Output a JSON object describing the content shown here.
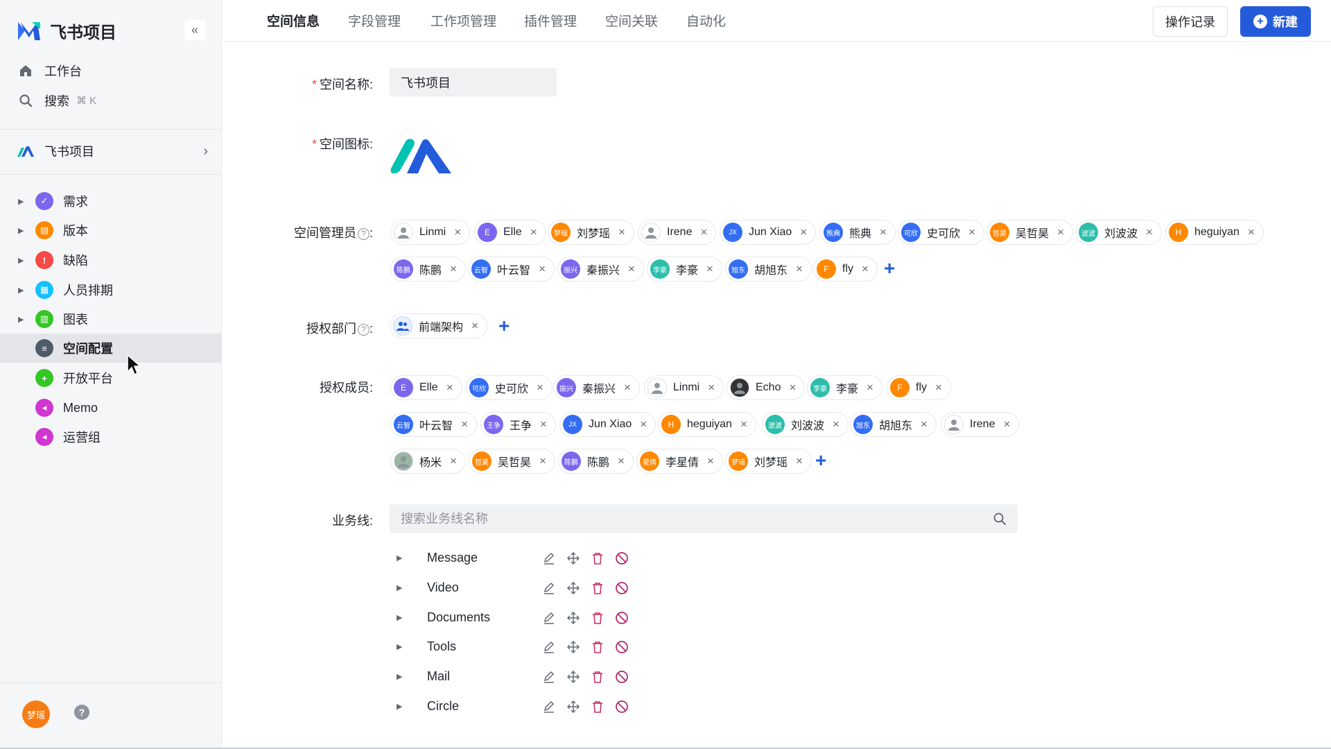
{
  "colors": {
    "primary": "#245bdb",
    "danger": "#f54a45",
    "sidebar_bg": "#f5f6f7",
    "trash": "#c73064",
    "ban": "#b2226b"
  },
  "sidebar": {
    "brand": "飞书项目",
    "collapse_icon": "double-chevron-left-icon",
    "workbench": "工作台",
    "search": "搜索",
    "search_shortcut": "⌘ K",
    "space_name": "飞书项目",
    "tree": [
      {
        "label": "需求",
        "icon": "requirement-icon",
        "color": "#7b67ee",
        "glyph": "✓"
      },
      {
        "label": "版本",
        "icon": "version-icon",
        "color": "#ff8800",
        "glyph": "▤"
      },
      {
        "label": "缺陷",
        "icon": "bug-icon",
        "color": "#f54a45",
        "glyph": "!"
      },
      {
        "label": "人员排期",
        "icon": "schedule-icon",
        "color": "#14c0ff",
        "glyph": "▦"
      },
      {
        "label": "图表",
        "icon": "chart-icon",
        "color": "#34c724",
        "glyph": "▥"
      },
      {
        "label": "空间配置",
        "icon": "settings-icon",
        "color": "#4e5969",
        "glyph": "≡"
      },
      {
        "label": "开放平台",
        "icon": "open-platform-icon",
        "color": "#34c724",
        "glyph": "+"
      },
      {
        "label": "Memo",
        "icon": "memo-icon",
        "color": "#d136d1",
        "glyph": "◂"
      },
      {
        "label": "运营组",
        "icon": "ops-icon",
        "color": "#d136d1",
        "glyph": "◂"
      }
    ],
    "user_avatar_text": "梦瑶",
    "help_glyph": "?"
  },
  "tabs": [
    "空间信息",
    "字段管理",
    "工作项管理",
    "插件管理",
    "空间关联",
    "自动化"
  ],
  "actions": {
    "log": "操作记录",
    "new": "新建"
  },
  "form": {
    "name_label": "空间名称:",
    "name_value": "飞书项目",
    "icon_label": "空间图标:",
    "admin_label": "空间管理员",
    "dept_label": "授权部门",
    "member_label": "授权成员:",
    "bizline_label": "业务线:",
    "bizline_placeholder": "搜索业务线名称"
  },
  "admins": [
    {
      "name": "Linmi",
      "av": "",
      "color": "#ffffff",
      "photo": true
    },
    {
      "name": "Elle",
      "av": "E",
      "color": "#7b67ee"
    },
    {
      "name": "刘梦瑶",
      "av": "梦瑶",
      "color": "#ff8800"
    },
    {
      "name": "Irene",
      "av": "",
      "color": "#ffffff",
      "photo": true
    },
    {
      "name": "Jun Xiao",
      "av": "JX",
      "color": "#336df4"
    },
    {
      "name": "熊典",
      "av": "熊典",
      "color": "#336df4"
    },
    {
      "name": "史可欣",
      "av": "可欣",
      "color": "#336df4"
    },
    {
      "name": "吴哲昊",
      "av": "哲昊",
      "color": "#ff8800"
    },
    {
      "name": "刘波波",
      "av": "波波",
      "color": "#2dbeab"
    },
    {
      "name": "heguiyan",
      "av": "H",
      "color": "#ff8800"
    },
    {
      "name": "陈鹏",
      "av": "陈鹏",
      "color": "#7b67ee"
    },
    {
      "name": "叶云智",
      "av": "云智",
      "color": "#336df4"
    },
    {
      "name": "秦振兴",
      "av": "振兴",
      "color": "#7b67ee"
    },
    {
      "name": "李豪",
      "av": "李豪",
      "color": "#2dbeab"
    },
    {
      "name": "胡旭东",
      "av": "旭东",
      "color": "#336df4"
    },
    {
      "name": "fly",
      "av": "F",
      "color": "#ff8800"
    }
  ],
  "departments": [
    {
      "name": "前端架构"
    }
  ],
  "members": [
    {
      "name": "Elle",
      "av": "E",
      "color": "#7b67ee"
    },
    {
      "name": "史可欣",
      "av": "可欣",
      "color": "#336df4"
    },
    {
      "name": "秦振兴",
      "av": "振兴",
      "color": "#7b67ee"
    },
    {
      "name": "Linmi",
      "av": "",
      "color": "#ffffff",
      "photo": true
    },
    {
      "name": "Echo",
      "av": "",
      "color": "#333333",
      "photo": true
    },
    {
      "name": "李豪",
      "av": "李豪",
      "color": "#2dbeab"
    },
    {
      "name": "fly",
      "av": "F",
      "color": "#ff8800"
    },
    {
      "name": "叶云智",
      "av": "云智",
      "color": "#336df4"
    },
    {
      "name": "王争",
      "av": "王争",
      "color": "#7b67ee"
    },
    {
      "name": "Jun Xiao",
      "av": "JX",
      "color": "#336df4"
    },
    {
      "name": "heguiyan",
      "av": "H",
      "color": "#ff8800"
    },
    {
      "name": "刘波波",
      "av": "波波",
      "color": "#2dbeab"
    },
    {
      "name": "胡旭东",
      "av": "旭东",
      "color": "#336df4"
    },
    {
      "name": "Irene",
      "av": "",
      "color": "#ffffff",
      "photo": true
    },
    {
      "name": "杨米",
      "av": "",
      "color": "#9bb5a5",
      "photo": true
    },
    {
      "name": "吴哲昊",
      "av": "哲昊",
      "color": "#ff8800"
    },
    {
      "name": "陈鹏",
      "av": "陈鹏",
      "color": "#7b67ee"
    },
    {
      "name": "李星倩",
      "av": "星倩",
      "color": "#ff8800"
    },
    {
      "name": "刘梦瑶",
      "av": "梦瑶",
      "color": "#ff8800"
    }
  ],
  "business_lines": [
    "Message",
    "Video",
    "Documents",
    "Tools",
    "Mail",
    "Circle"
  ]
}
